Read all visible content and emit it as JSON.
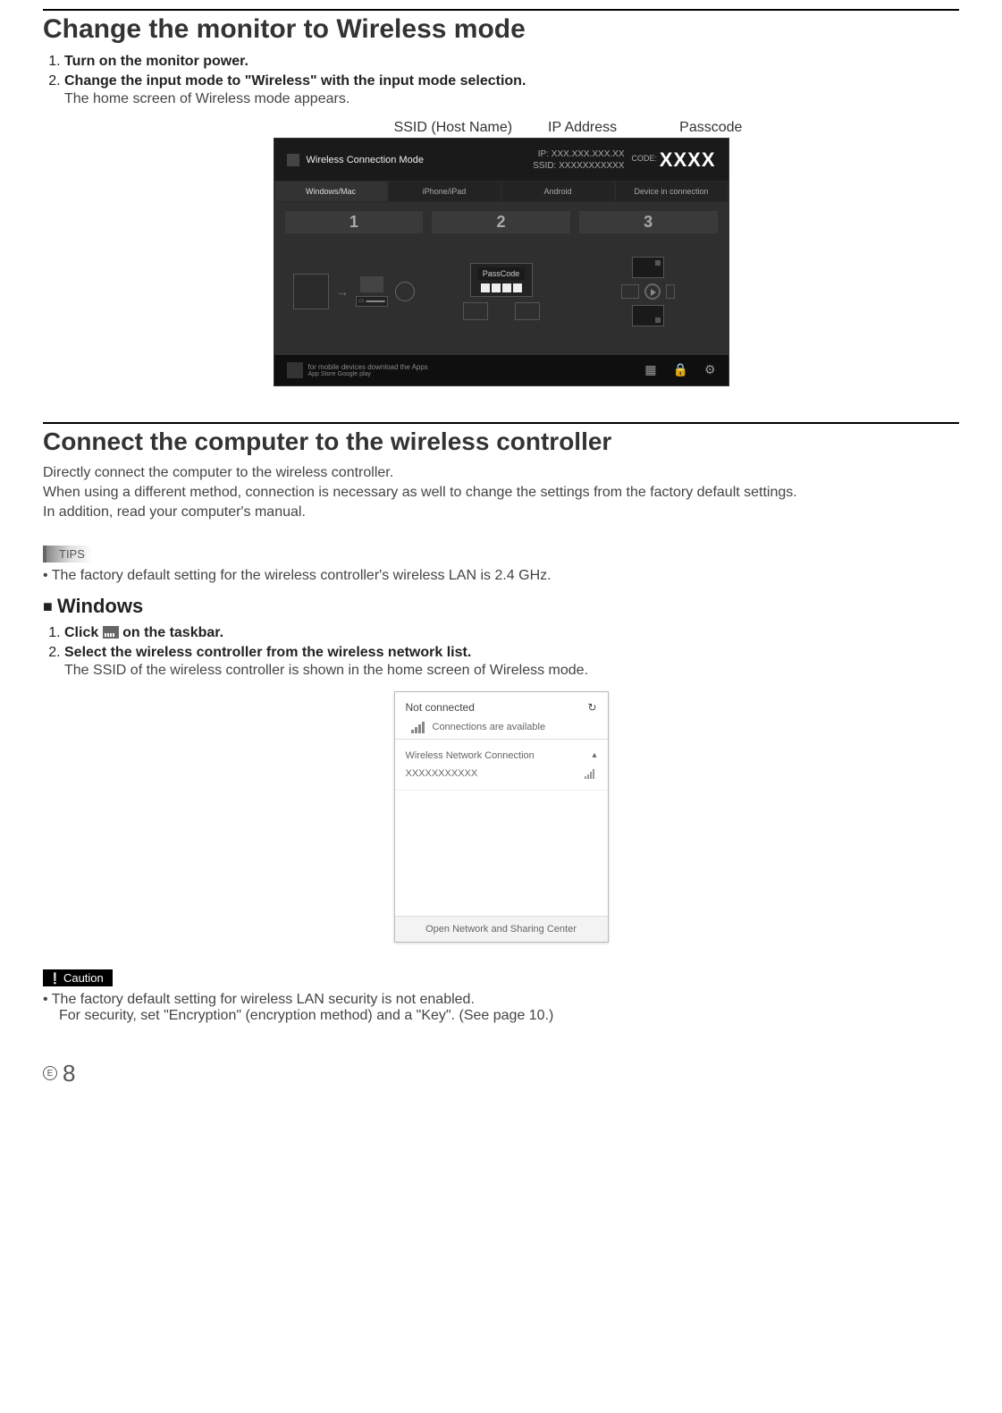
{
  "section1": {
    "title": "Change the monitor to Wireless mode",
    "steps": [
      {
        "bold": "Turn on the monitor power."
      },
      {
        "bold": "Change the input mode to \"Wireless\" with the input mode selection.",
        "sub": "The home screen of Wireless mode appears."
      }
    ],
    "callouts": {
      "ssid": "SSID (Host Name)",
      "ip": "IP Address",
      "passcode": "Passcode"
    },
    "monitor": {
      "title": "Wireless Connection Mode",
      "ip_label": "IP:",
      "ip_value": "XXX.XXX.XXX.XX",
      "ssid_label": "SSID:",
      "ssid_value": "XXXXXXXXXXX",
      "code_label": "CODE:",
      "code_value": "XXXX",
      "tabs": [
        "Windows/Mac",
        "iPhone/iPad",
        "Android",
        "Device in connection"
      ],
      "col_nums": [
        "1",
        "2",
        "3"
      ],
      "passcode_word": "PassCode",
      "footer_text": "for mobile devices download the Apps",
      "footer_sub": "App Store   Google play"
    }
  },
  "section2": {
    "title": "Connect the computer to the wireless controller",
    "paras": [
      "Directly connect the computer to the wireless controller.",
      "When using a different method, connection is necessary as well to change the settings from the factory default settings.",
      "In addition, read your computer's manual."
    ],
    "tips_label": "TIPS",
    "tips_text": "The factory default setting for the wireless controller's wireless LAN is 2.4 GHz.",
    "windows_heading": "Windows",
    "win_steps": [
      {
        "pre": "Click ",
        "post": " on the taskbar."
      },
      {
        "bold": "Select the wireless controller from the wireless network list.",
        "sub": "The SSID of the wireless controller is shown in the home screen of Wireless mode."
      }
    ],
    "popup": {
      "not_connected": "Not connected",
      "available": "Connections are available",
      "section_label": "Wireless Network Connection",
      "ssid_placeholder": "XXXXXXXXXXX",
      "footer": "Open Network and Sharing Center"
    },
    "caution_label": "Caution",
    "caution_lines": [
      "The factory default setting for wireless LAN security is not enabled.",
      "For security, set \"Encryption\" (encryption method) and a \"Key\". (See page 10.)"
    ]
  },
  "page_number": "8",
  "page_letter": "E"
}
